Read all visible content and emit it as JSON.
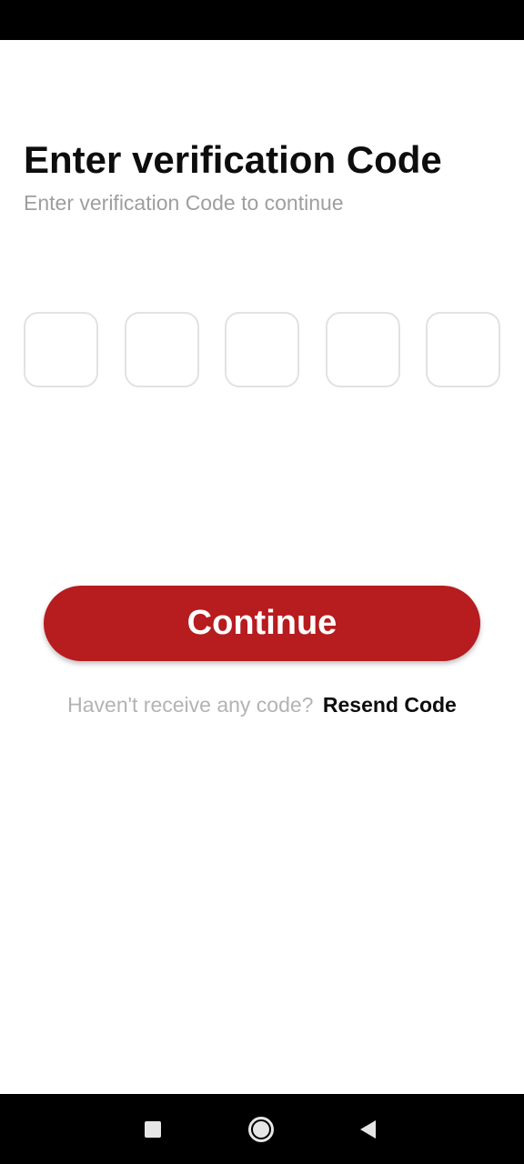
{
  "header": {
    "title": "Enter verification Code",
    "subtitle": "Enter verification Code to continue"
  },
  "otp": {
    "digits": [
      "",
      "",
      "",
      "",
      ""
    ]
  },
  "actions": {
    "continue_label": "Continue",
    "resend_prompt": "Haven't receive any code?",
    "resend_label": "Resend Code"
  },
  "colors": {
    "primary": "#b71c1f",
    "title_text": "#0d0d0d",
    "subtitle_text": "#9e9e9e",
    "otp_border": "#e2e2e2"
  },
  "system_nav": {
    "icons": [
      "recents-square-icon",
      "home-circle-icon",
      "back-triangle-icon"
    ]
  }
}
